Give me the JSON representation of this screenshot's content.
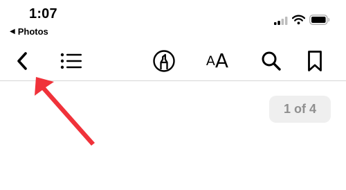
{
  "status_bar": {
    "time": "1:07",
    "back_app_label": "Photos",
    "back_app_glyph": "◀"
  },
  "toolbar": {
    "back_icon": "chevron-left-icon",
    "contents_icon": "list-icon",
    "markup_icon": "highlighter-icon",
    "text_size_label": {
      "small": "A",
      "big": "A"
    },
    "search_icon": "search-icon",
    "bookmark_icon": "bookmark-icon"
  },
  "page_indicator": {
    "label": "1 of 4"
  },
  "annotation": {
    "color": "#f0323a",
    "points_to": "back-button"
  },
  "colors": {
    "divider": "#d6d6d6",
    "badge_background": "#efefef",
    "badge_text": "#8f8f8f"
  }
}
